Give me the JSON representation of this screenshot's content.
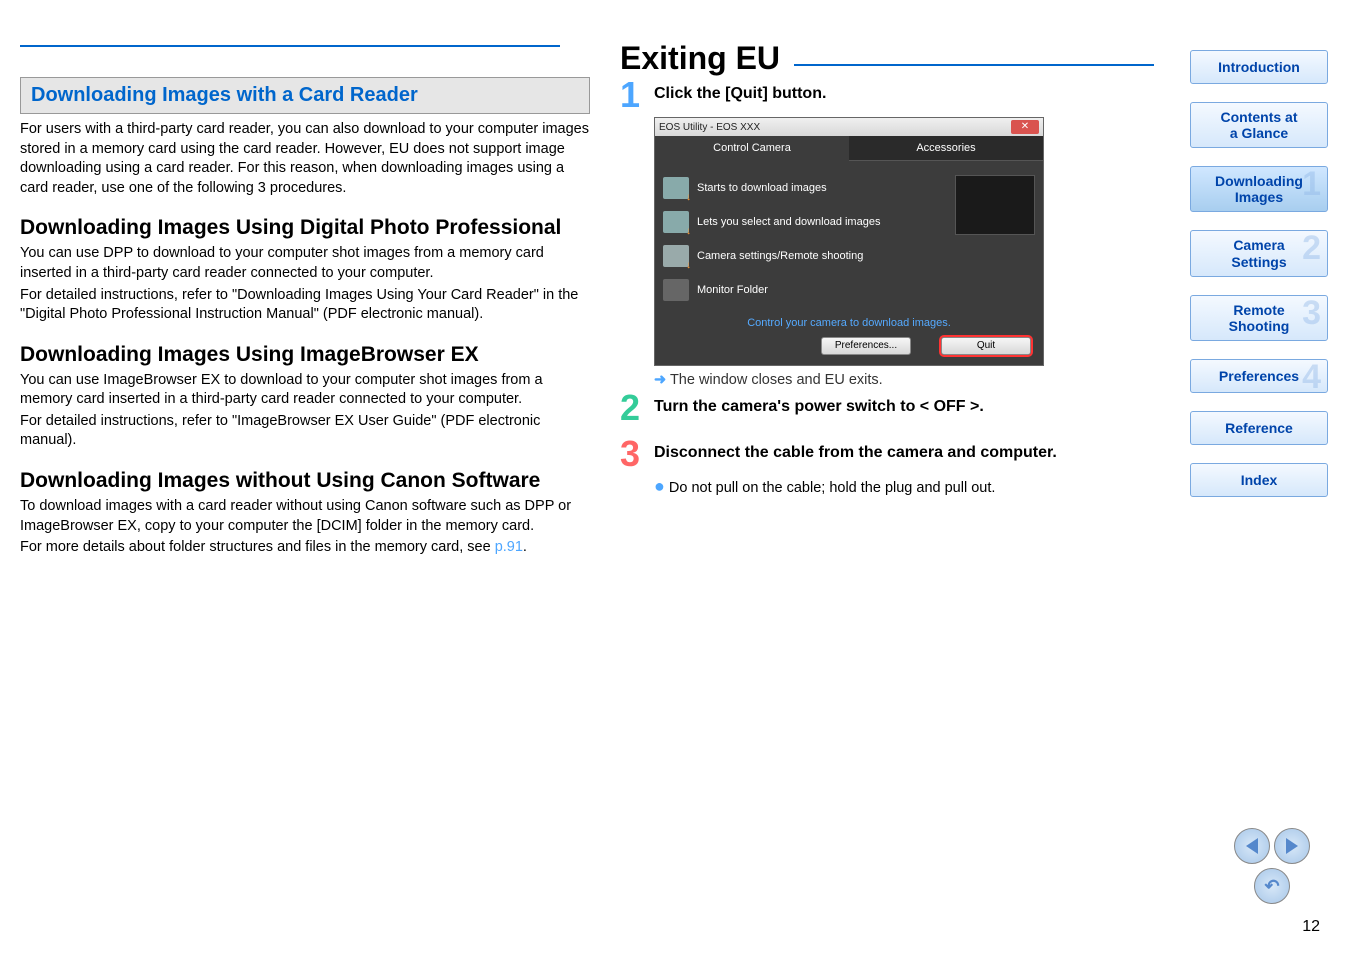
{
  "left": {
    "box_heading": "Downloading Images with a Card Reader",
    "intro": "For users with a third-party card reader, you can also download to your computer images stored in a memory card using the card reader. However, EU does not support image downloading using a card reader. For this reason, when downloading images using a card reader, use one of the following 3 procedures.",
    "h1": "Downloading Images Using Digital Photo Professional",
    "p1a": "You can use DPP to download to your computer shot images from a memory card inserted in a third-party card reader connected to your computer.",
    "p1b": "For detailed instructions, refer to \"Downloading Images Using Your Card Reader\" in the \"Digital Photo Professional Instruction Manual\" (PDF electronic manual).",
    "h2": "Downloading Images Using ImageBrowser EX",
    "p2a": "You can use ImageBrowser EX to download to your computer shot images from a memory card inserted in a third-party card reader connected to your computer.",
    "p2b": "For detailed instructions, refer to \"ImageBrowser EX User Guide\" (PDF electronic manual).",
    "h3": "Downloading Images without Using Canon Software",
    "p3a": "To download images with a card reader without using Canon software such as DPP or ImageBrowser EX, copy to your computer the [DCIM] folder in the memory card.",
    "p3b_prefix": "For more details about folder structures and files in the memory card, see ",
    "p3b_link": "p.91",
    "p3b_suffix": "."
  },
  "right": {
    "title": "Exiting EU",
    "step1": "Click the [Quit] button.",
    "arrow_text": "The window closes and EU exits.",
    "step2": "Turn the camera's power switch to < OFF >.",
    "step3": "Disconnect the cable from the camera and computer.",
    "step3_sub": "Do not pull on the cable; hold the plug and pull out."
  },
  "shot": {
    "title": "EOS Utility - EOS XXX",
    "tab1": "Control Camera",
    "tab2": "Accessories",
    "row1": "Starts to download images",
    "row2": "Lets you select and download images",
    "row3": "Camera settings/Remote shooting",
    "row4": "Monitor Folder",
    "status": "Control your camera to download images.",
    "btn_pref": "Preferences...",
    "btn_quit": "Quit"
  },
  "nav": {
    "introduction": "Introduction",
    "contents_l1": "Contents at",
    "contents_l2": "a Glance",
    "dl_l1": "Downloading",
    "dl_l2": "Images",
    "cam_l1": "Camera",
    "cam_l2": "Settings",
    "rem_l1": "Remote",
    "rem_l2": "Shooting",
    "pref": "Preferences",
    "ref": "Reference",
    "index": "Index"
  },
  "page_number": "12"
}
